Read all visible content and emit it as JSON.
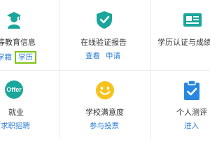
{
  "colors": {
    "teal": "#1aa69b",
    "link": "#2f7fd6",
    "highlight": "#7dc314",
    "smile": "#f7c21b",
    "check": "#2a87e0"
  },
  "tiles": [
    {
      "icon": "graduate-icon",
      "title": "等教育信息",
      "links": [
        "学籍",
        "学历"
      ]
    },
    {
      "icon": "shield-check-icon",
      "title": "在线验证报告",
      "links": [
        "查看",
        "申请"
      ]
    },
    {
      "icon": "certificate-card-icon",
      "title": "学历认证与成绩",
      "links": []
    },
    {
      "icon": "offer-icon",
      "icon_text": "Offer",
      "title": "就业",
      "links": [
        "求职招聘"
      ]
    },
    {
      "icon": "smile-icon",
      "title": "学校满意度",
      "links": [
        "参与投票"
      ]
    },
    {
      "icon": "clipboard-check-icon",
      "title": "个人测评",
      "links": [
        "进入"
      ]
    }
  ]
}
